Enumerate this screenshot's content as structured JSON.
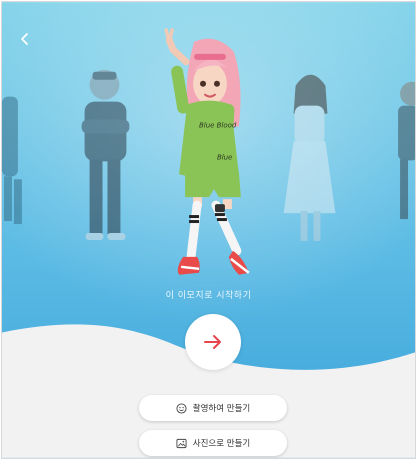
{
  "caption": "이 이모지로 시작하기",
  "actions": {
    "camera_label": "촬영하여 만들기",
    "photo_label": "사진으로 만들기"
  },
  "icons": {
    "back": "chevron-left-icon",
    "start": "arrow-right-icon",
    "camera": "smiley-icon",
    "photo": "image-icon"
  },
  "colors": {
    "sky_top": "#7fd0e8",
    "sky_bottom": "#3aa6dc",
    "arrow": "#e8444e",
    "hoodie": "#8bc456",
    "hair": "#f4a3b4"
  }
}
